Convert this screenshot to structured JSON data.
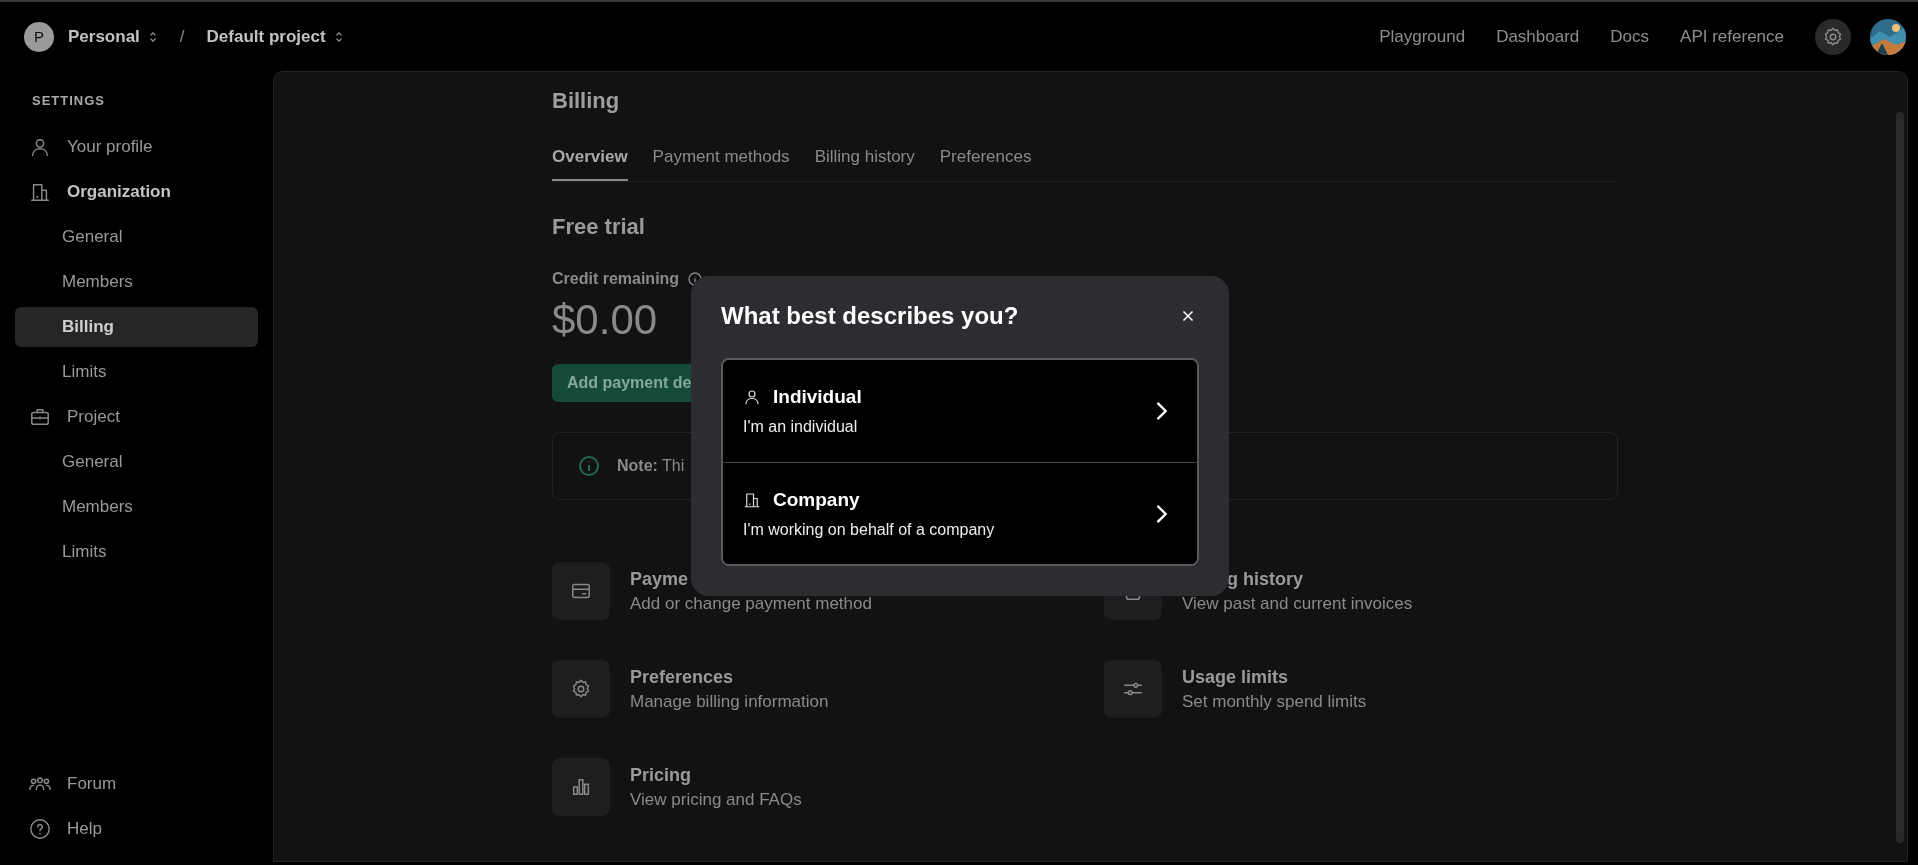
{
  "topbar": {
    "org": {
      "initial": "P",
      "name": "Personal"
    },
    "separator": "/",
    "project": "Default project",
    "links": [
      "Playground",
      "Dashboard",
      "Docs",
      "API reference"
    ]
  },
  "sidebar": {
    "heading": "SETTINGS",
    "items": [
      {
        "kind": "section",
        "label": "Your profile",
        "active": false
      },
      {
        "kind": "section",
        "label": "Organization",
        "active": true
      },
      {
        "kind": "sub",
        "label": "General",
        "selected": false
      },
      {
        "kind": "sub",
        "label": "Members",
        "selected": false
      },
      {
        "kind": "sub",
        "label": "Billing",
        "selected": true
      },
      {
        "kind": "sub",
        "label": "Limits",
        "selected": false
      },
      {
        "kind": "section",
        "label": "Project",
        "active": false
      },
      {
        "kind": "sub",
        "label": "General",
        "selected": false
      },
      {
        "kind": "sub",
        "label": "Members",
        "selected": false
      },
      {
        "kind": "sub",
        "label": "Limits",
        "selected": false
      }
    ],
    "footer": [
      {
        "label": "Forum"
      },
      {
        "label": "Help"
      }
    ]
  },
  "billing": {
    "title": "Billing",
    "tabs": [
      {
        "label": "Overview",
        "selected": true
      },
      {
        "label": "Payment methods",
        "selected": false
      },
      {
        "label": "Billing history",
        "selected": false
      },
      {
        "label": "Preferences",
        "selected": false
      }
    ],
    "plan": "Free trial",
    "credit_label": "Credit remaining",
    "credit": "$0.00",
    "add_button": "Add payment de",
    "note": "**Note:** Thi",
    "cards": [
      {
        "title": "Payme",
        "subtitle": "Add or change payment method"
      },
      {
        "title": "g history",
        "subtitle": "View past and current invoices"
      },
      {
        "title": "Preferences",
        "subtitle": "Manage billing information"
      },
      {
        "title": "Usage limits",
        "subtitle": "Set monthly spend limits"
      },
      {
        "title": "Pricing",
        "subtitle": "View pricing and FAQs"
      }
    ]
  },
  "dialog": {
    "title": "What best describes you?",
    "options": [
      {
        "title": "Individual",
        "subtitle": "I'm an individual"
      },
      {
        "title": "Company",
        "subtitle": "I'm working on behalf of a company"
      }
    ]
  }
}
